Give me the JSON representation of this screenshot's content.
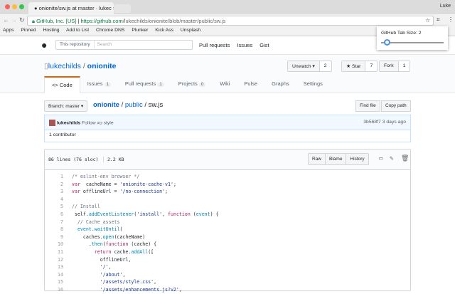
{
  "browser": {
    "tab_title": "onionite/sw.js at master · lukec",
    "user": "Luke",
    "secure_label": "GitHub, Inc. [US]",
    "url_prefix": "https://github.com",
    "url_path": "/lukechilds/onionite/blob/master/public/sw.js"
  },
  "bookmarks": [
    "Apps",
    "Pinned",
    "Hosting",
    "Add to List",
    "Chrome DNS",
    "Plunker",
    "Kick Ass",
    "Unsplash"
  ],
  "extension_popup": {
    "label": "GitHub Tab Size: 2",
    "slider_value": 2
  },
  "github": {
    "search_scope": "This repository",
    "search_placeholder": "Search",
    "nav": [
      "Pull requests",
      "Issues",
      "Gist"
    ]
  },
  "repo": {
    "owner": "lukechilds",
    "sep": "/",
    "name": "onionite",
    "actions": [
      {
        "label": "Unwatch ▾",
        "count": "2"
      },
      {
        "label": "★ Star",
        "count": "7"
      },
      {
        "label": "Fork",
        "count": "1"
      }
    ],
    "tabs": [
      {
        "label": "<> Code",
        "count": ""
      },
      {
        "label": "Issues",
        "count": "1"
      },
      {
        "label": "Pull requests",
        "count": "1"
      },
      {
        "label": "Projects",
        "count": "0"
      },
      {
        "label": "Wiki",
        "count": ""
      },
      {
        "label": "Pulse",
        "count": ""
      },
      {
        "label": "Graphs",
        "count": ""
      },
      {
        "label": "Settings",
        "count": ""
      }
    ]
  },
  "file": {
    "branch": "Branch: master ▾",
    "path": [
      "onionite",
      "public",
      "sw.js"
    ],
    "find_file": "Find file",
    "copy_path": "Copy path",
    "commit_author": "lukechilds",
    "commit_msg": "Follow xo style",
    "commit_sha": "3b568f7",
    "commit_time": "3 days ago",
    "contributors": "1 contributor",
    "lines_info": "86 lines (76 sloc)",
    "size": "2.2 KB",
    "raw": "Raw",
    "blame": "Blame",
    "history": "History"
  },
  "code": [
    [
      [
        "c",
        "/* eslint-env browser */"
      ]
    ],
    [
      [
        "k",
        "var"
      ],
      [
        "",
        "  cacheName = "
      ],
      [
        "s",
        "'onionite-cache-v1'"
      ],
      [
        "",
        ";"
      ]
    ],
    [
      [
        "k",
        "var"
      ],
      [
        "",
        " offlineUrl = "
      ],
      [
        "s",
        "'/no-connection'"
      ],
      [
        "",
        ";"
      ]
    ],
    [],
    [
      [
        "c",
        "// Install"
      ]
    ],
    [
      [
        "",
        " self."
      ],
      [
        "e",
        "addEventListener"
      ],
      [
        "",
        "("
      ],
      [
        "s",
        "'install'"
      ],
      [
        "",
        ", "
      ],
      [
        "k",
        "function"
      ],
      [
        "",
        " ("
      ],
      [
        "e",
        "event"
      ],
      [
        "",
        ") {"
      ]
    ],
    [
      [
        "c",
        "  // Cache assets"
      ]
    ],
    [
      [
        "e",
        "  event.waitUntil"
      ],
      [
        "",
        "("
      ]
    ],
    [
      [
        "",
        "    caches."
      ],
      [
        "e",
        "open"
      ],
      [
        "",
        "(cacheName)"
      ]
    ],
    [
      [
        "",
        "      ."
      ],
      [
        "e",
        "then"
      ],
      [
        "",
        "("
      ],
      [
        "k",
        "function"
      ],
      [
        "",
        " (cache) {"
      ]
    ],
    [
      [
        "k",
        "        return"
      ],
      [
        "",
        " cache."
      ],
      [
        "e",
        "addAll"
      ],
      [
        "",
        "(["
      ]
    ],
    [
      [
        "",
        "          offlineUrl,"
      ]
    ],
    [
      [
        "s",
        "          '/'"
      ],
      [
        "",
        ","
      ]
    ],
    [
      [
        "s",
        "          '/about'"
      ],
      [
        "",
        ","
      ]
    ],
    [
      [
        "s",
        "          '/assets/style.css'"
      ],
      [
        "",
        ","
      ]
    ],
    [
      [
        "s",
        "          '/assets/enhancements.js?v2'"
      ],
      [
        "",
        ","
      ]
    ]
  ]
}
